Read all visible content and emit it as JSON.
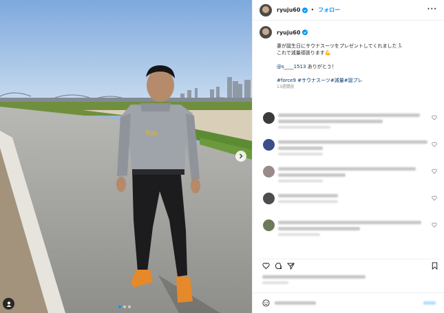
{
  "colors": {
    "sky": "#9bbbe0",
    "accent": "#0095f6",
    "hashtag": "#00376b",
    "muted": "#8e8e8e",
    "shoes": "#e5892a"
  },
  "post": {
    "username": "ryuju60",
    "follow_label": "フォロー",
    "more_icon": "more-horizontal-icon",
    "verified_icon": "verified-badge-icon"
  },
  "photo": {
    "shirt_text": "Ryu",
    "current_slide": 1,
    "slide_count": 3
  },
  "caption": {
    "username": "ryuju60",
    "line1": "妻が誕生日にサウナスーツをプレゼントしてくれました",
    "line1_emoji": "🏃",
    "line2": "これで減量頑張ります",
    "line2_emoji": "💪",
    "mention": "@s____1513",
    "mention_suffix": " ありがとう！",
    "hashtags": "#force9 #サウナスーツ#減量#誕プレ",
    "time_ago": "13週間前"
  },
  "comments": {
    "count_visible": 5
  },
  "actions": {
    "icons": [
      "heart-icon",
      "comment-icon",
      "share-icon",
      "bookmark-icon"
    ]
  }
}
